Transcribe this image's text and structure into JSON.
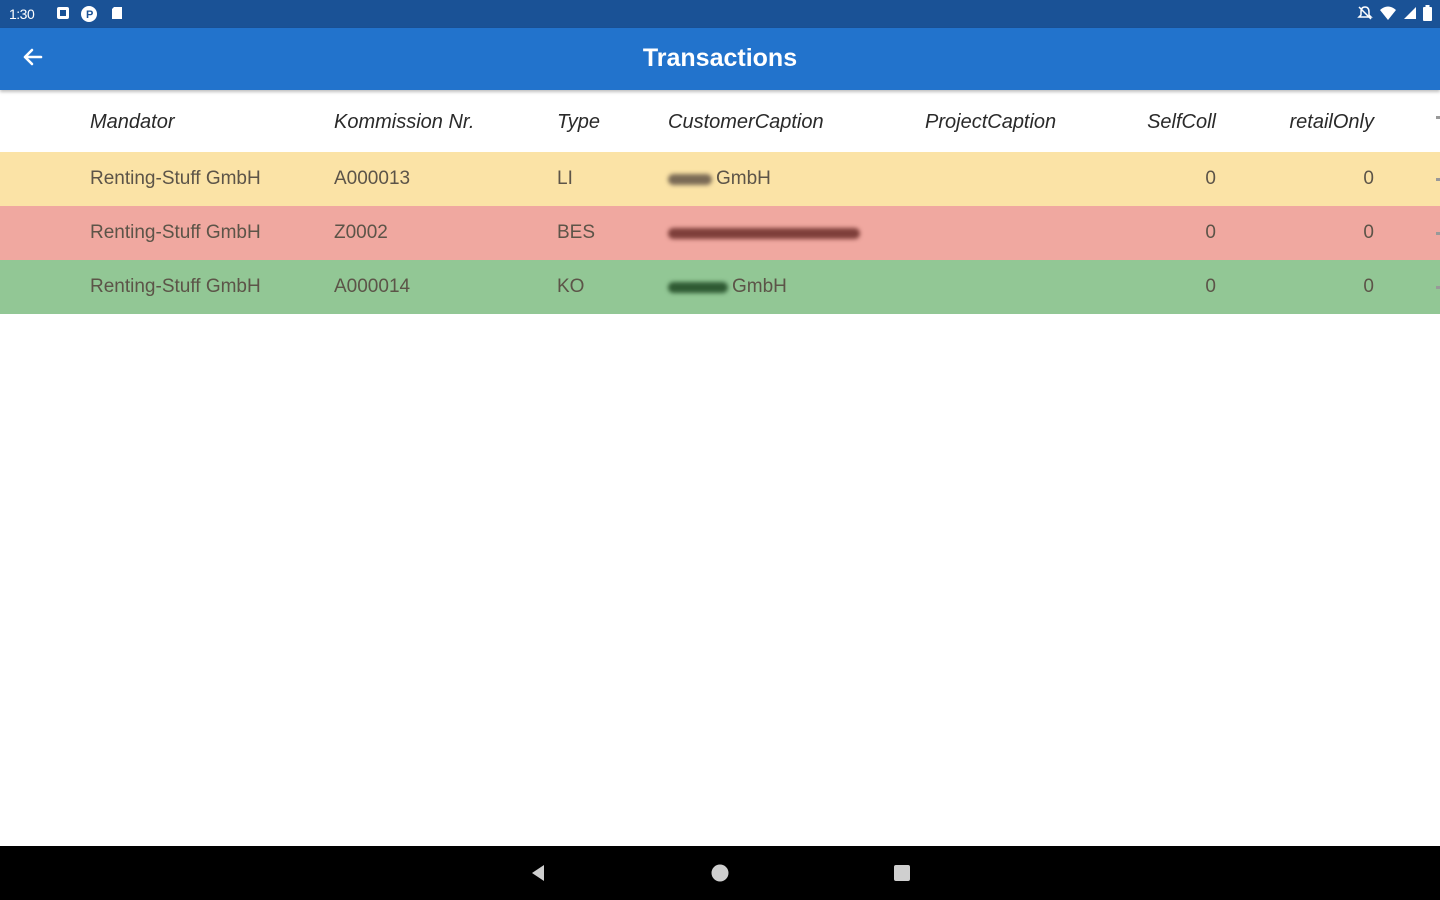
{
  "status_bar": {
    "time": "1:30",
    "left_icons": [
      "notification-icon",
      "p-app-icon",
      "sd-card-icon"
    ],
    "right_icons": [
      "mute-icon",
      "wifi-icon",
      "signal-icon",
      "battery-icon"
    ]
  },
  "app_bar": {
    "title": "Transactions",
    "back_icon": "arrow-left-icon"
  },
  "table": {
    "columns": [
      "Mandator",
      "Kommission Nr.",
      "Type",
      "CustomerCaption",
      "ProjectCaption",
      "SelfColl",
      "retailOnly"
    ],
    "rows": [
      {
        "mandator": "Renting-Stuff GmbH",
        "kommission_nr": "A000013",
        "type": "LI",
        "customer_caption": "GmbH",
        "project_caption": "",
        "self_coll": "0",
        "retail_only": "0",
        "color": "#fbe3a6"
      },
      {
        "mandator": "Renting-Stuff GmbH",
        "kommission_nr": "Z0002",
        "type": "BES",
        "customer_caption": "",
        "project_caption": "",
        "self_coll": "0",
        "retail_only": "0",
        "color": "#f0a8a0"
      },
      {
        "mandator": "Renting-Stuff GmbH",
        "kommission_nr": "A000014",
        "type": "KO",
        "customer_caption": "GmbH",
        "project_caption": "",
        "self_coll": "0",
        "retail_only": "0",
        "color": "#92c795"
      }
    ]
  },
  "nav_bar": {
    "icons": [
      "back-triangle-icon",
      "home-circle-icon",
      "recents-square-icon"
    ]
  },
  "colors": {
    "status_bar": "#1a5296",
    "app_bar": "#2273cc",
    "row_yellow": "#fbe3a6",
    "row_red": "#f0a8a0",
    "row_green": "#92c795"
  }
}
